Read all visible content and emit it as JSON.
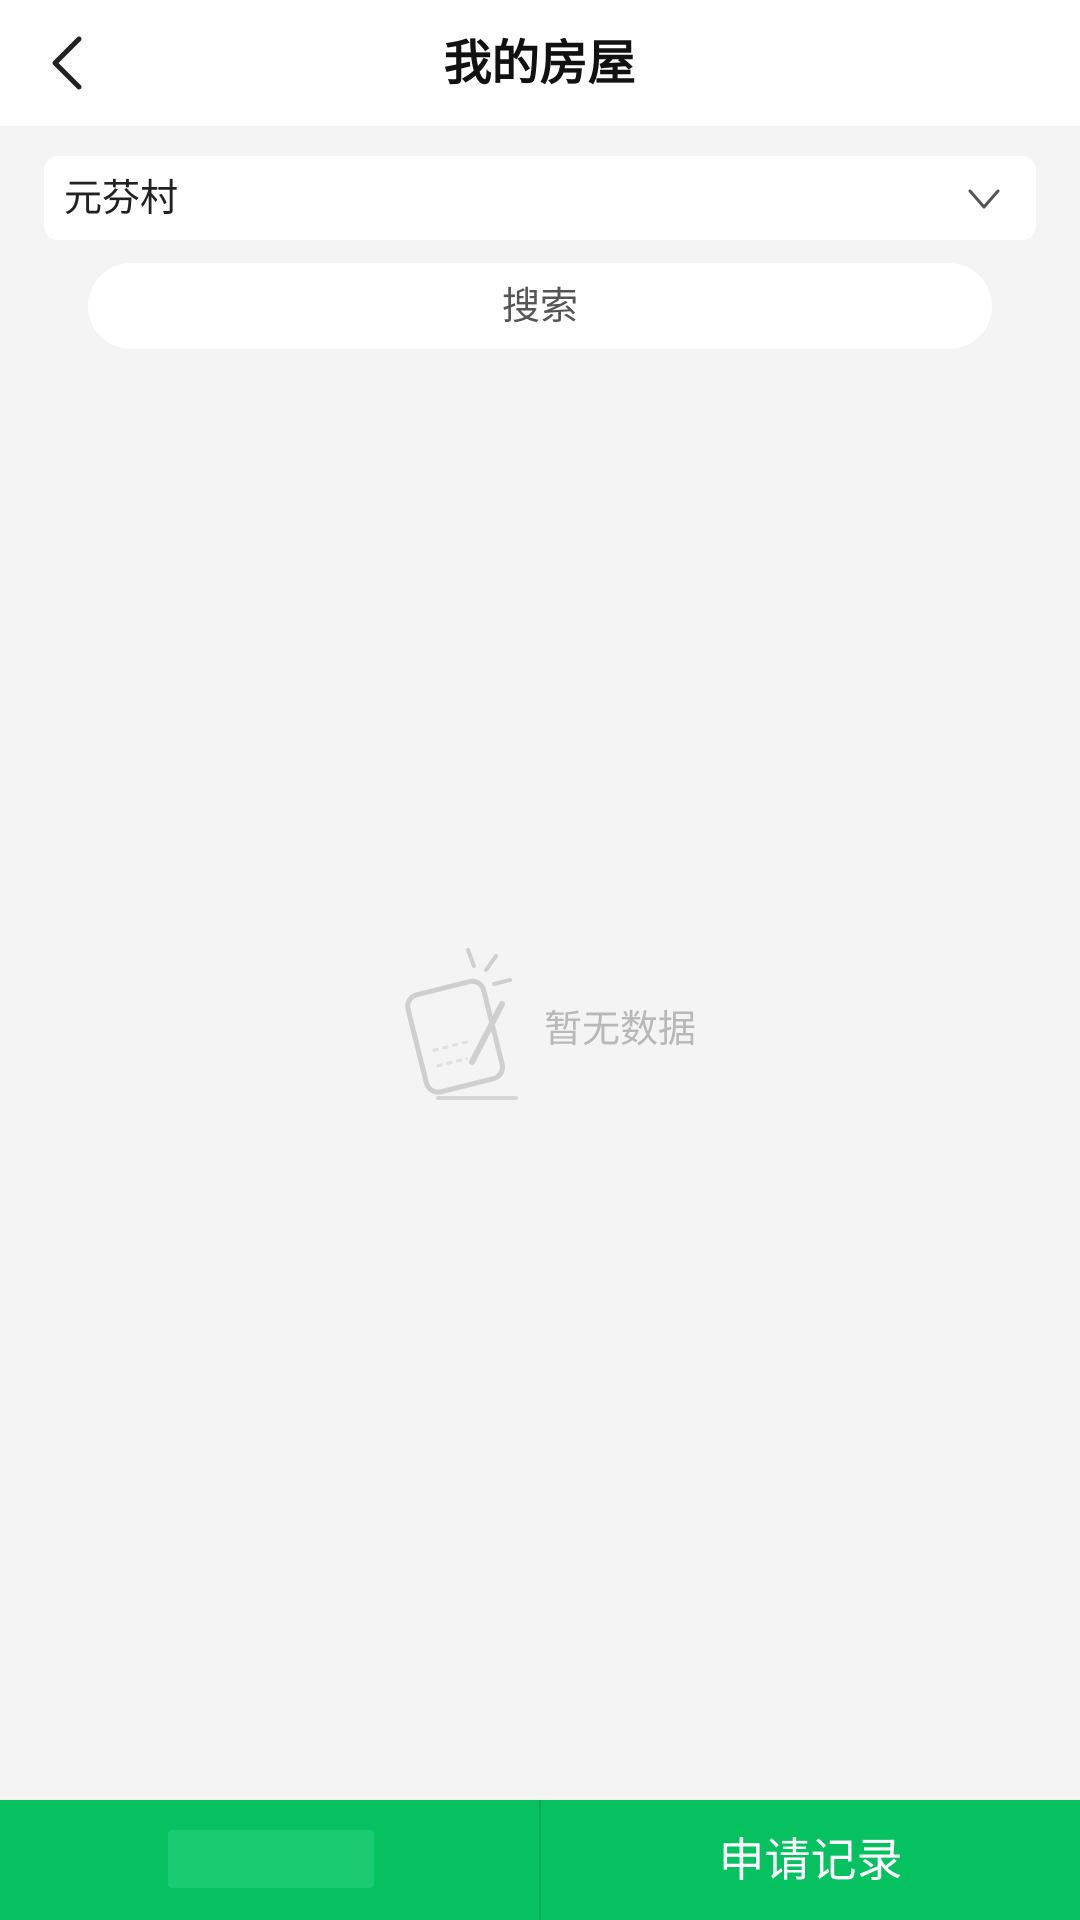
{
  "header": {
    "title": "我的房屋",
    "back_icon": "chevron-left-icon"
  },
  "filter": {
    "village_selected": "元芬村",
    "dropdown_icon": "chevron-down-icon",
    "search_label": "搜索"
  },
  "empty_state": {
    "icon": "document-edit-icon",
    "text": "暂无数据"
  },
  "footer": {
    "left_label": "",
    "right_label": "申请记录"
  },
  "colors": {
    "accent": "#06c160",
    "background": "#f4f4f4",
    "surface": "#ffffff",
    "empty_text": "#b8b8b8"
  }
}
